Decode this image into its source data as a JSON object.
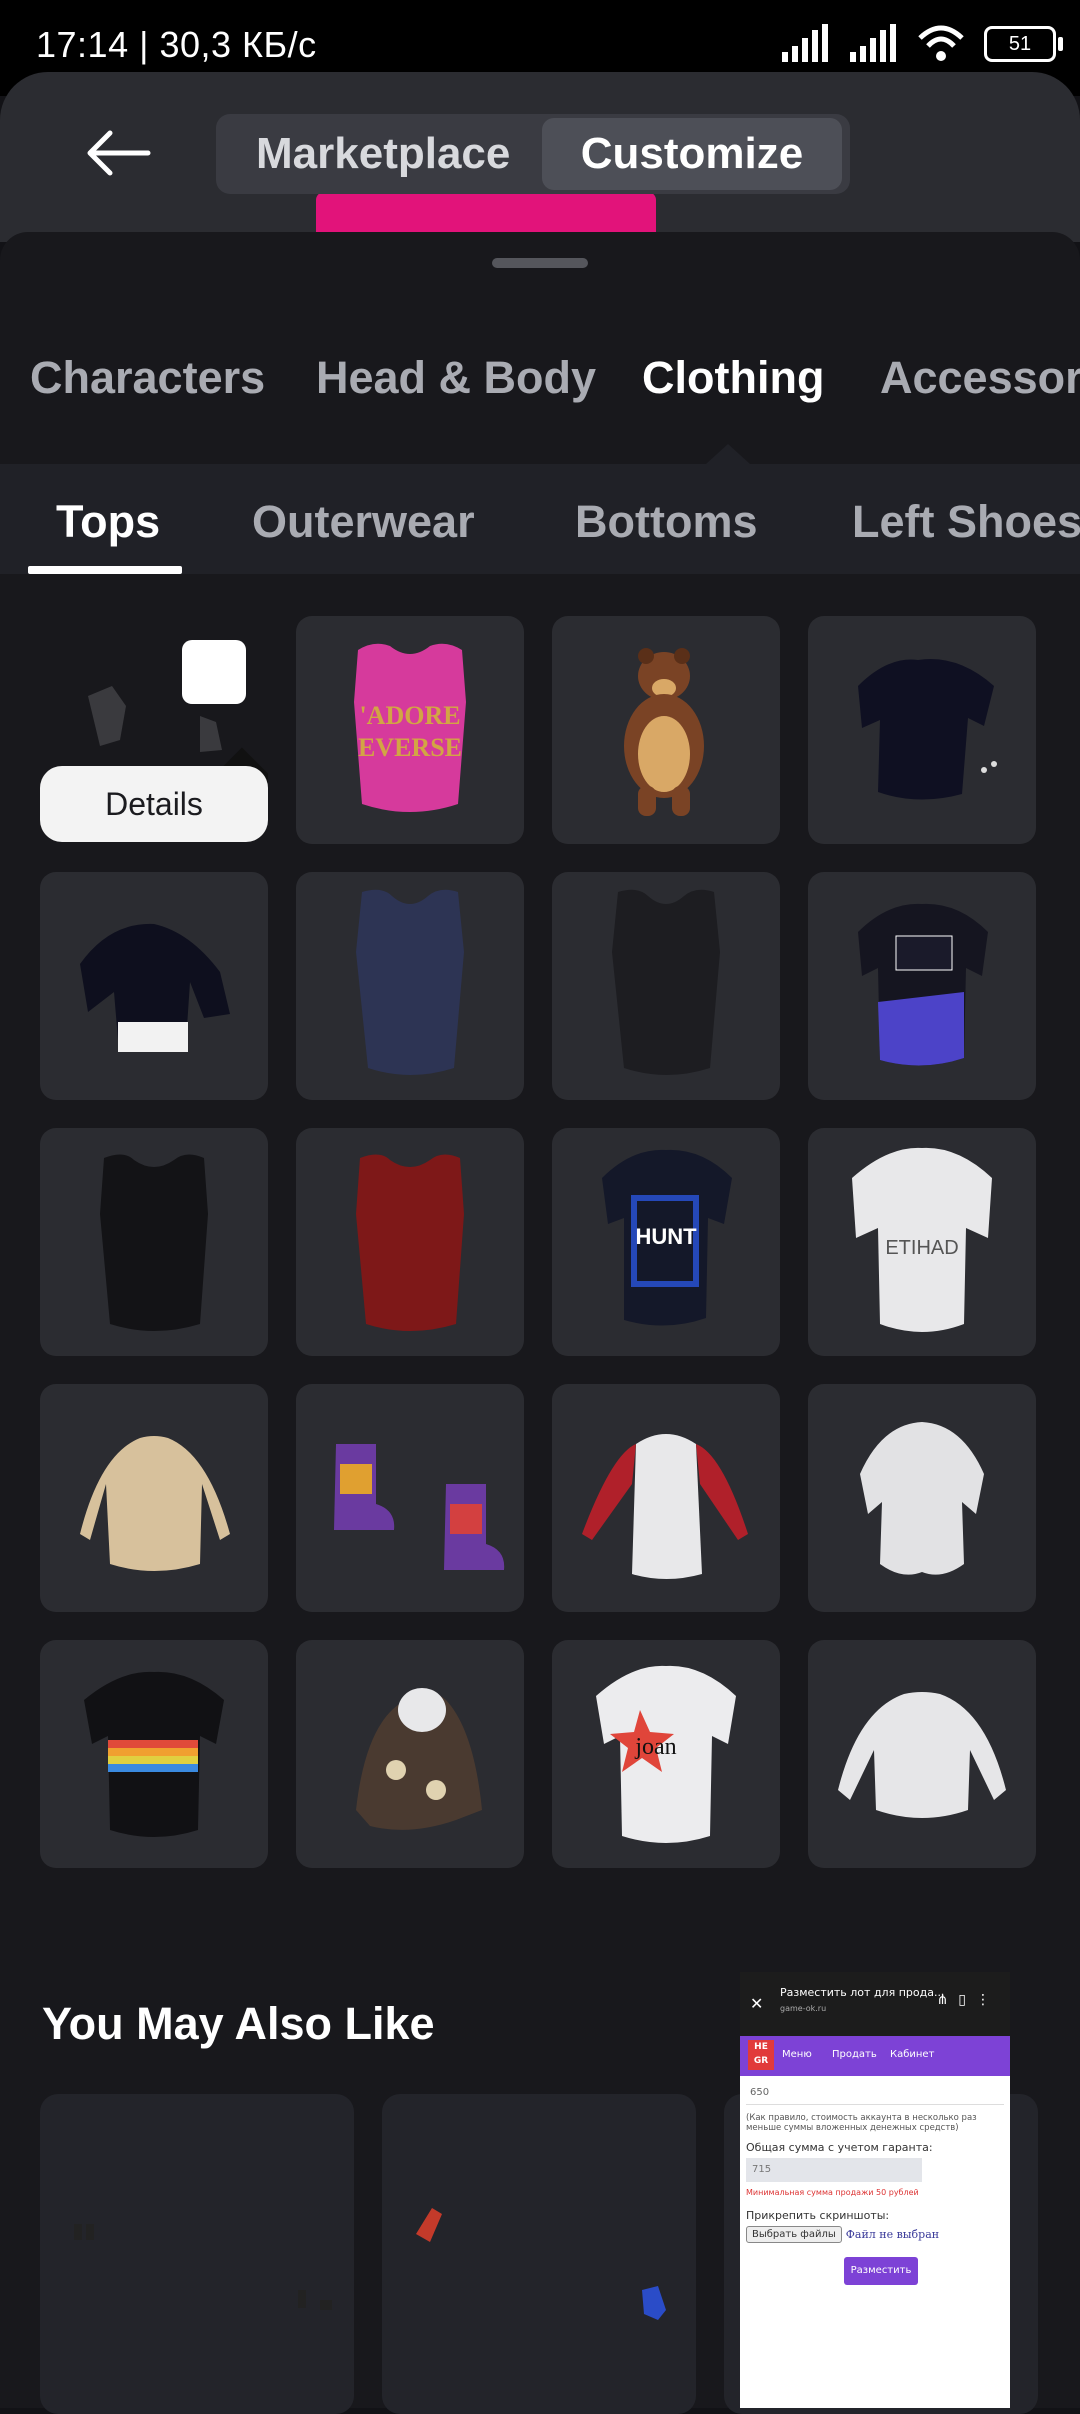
{
  "status_bar": {
    "text": "17:14 | 30,3 КБ/с",
    "battery": "51"
  },
  "header": {
    "tabs": [
      "Marketplace",
      "Customize"
    ],
    "active_tab": "Customize"
  },
  "categories": [
    "Characters",
    "Head & Body",
    "Clothing",
    "Accessori"
  ],
  "active_category": "Clothing",
  "subcategories": [
    "Tops",
    "Outerwear",
    "Bottoms",
    "Left Shoes"
  ],
  "active_subcategory": "Tops",
  "grid": {
    "details_label": "Details",
    "items": [
      {
        "icon": "gloves-icon",
        "selected": true
      },
      {
        "icon": "pink-tank-top-icon",
        "text": "ADORE EVERSE"
      },
      {
        "icon": "bear-icon"
      },
      {
        "icon": "black-tshirt-icon"
      },
      {
        "icon": "black-sweater-icon"
      },
      {
        "icon": "navy-tank-top-icon"
      },
      {
        "icon": "black-tank-top-icon"
      },
      {
        "icon": "black-blue-tshirt-icon"
      },
      {
        "icon": "black-tank-top-icon"
      },
      {
        "icon": "red-tank-top-icon"
      },
      {
        "icon": "hunt-tshirt-icon",
        "text": "HUNT"
      },
      {
        "icon": "white-jersey-icon",
        "text": "ETIHAD"
      },
      {
        "icon": "beige-sweater-icon"
      },
      {
        "icon": "boots-icon"
      },
      {
        "icon": "raglan-shirt-icon"
      },
      {
        "icon": "white-blouse-icon"
      },
      {
        "icon": "rainbow-tshirt-icon"
      },
      {
        "icon": "hoodie-icon"
      },
      {
        "icon": "joan-tshirt-icon",
        "text": "joan"
      },
      {
        "icon": "white-sweatshirt-icon"
      }
    ]
  },
  "you_may_also_like": {
    "title": "You May Also Like"
  },
  "preview": {
    "title": "Разместить лот для прода...",
    "url": "game-ok.ru",
    "logo": "HE GR",
    "menu": [
      "Меню",
      "Продать",
      "Кабинет"
    ],
    "value1": "650",
    "note": "(Как правило, стоимость аккаунта в несколько раз меньше суммы вложенных денежных средств)",
    "total_label": "Общая сумма с учетом гаранта:",
    "total_value": "715",
    "min_note": "Минимальная сумма продажи 50 рублей",
    "attach_label": "Прикрепить скриншоты:",
    "choose_files": "Выбрать файлы",
    "no_file": "Файл не выбран",
    "submit": "Разместить"
  },
  "colors": {
    "background": "#18181c",
    "tile": "#2b2c31",
    "accent_purple": "#7d42d6"
  }
}
